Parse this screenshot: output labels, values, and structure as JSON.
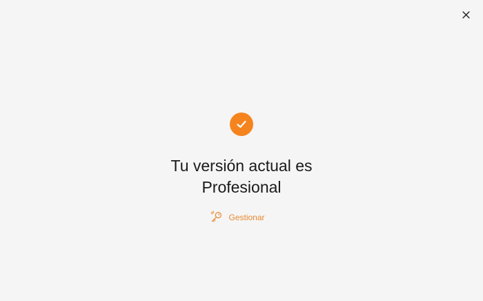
{
  "window": {
    "close_icon": "close-icon"
  },
  "status": {
    "icon": "check-circle-icon",
    "title": "Tu versión actual es Profesional"
  },
  "actions": {
    "manage_icon": "key-icon",
    "manage_label": "Gestionar"
  },
  "colors": {
    "accent": "#f5841f",
    "link": "#e8892f",
    "background": "#f5f5f5",
    "text": "#1a1a1a"
  }
}
